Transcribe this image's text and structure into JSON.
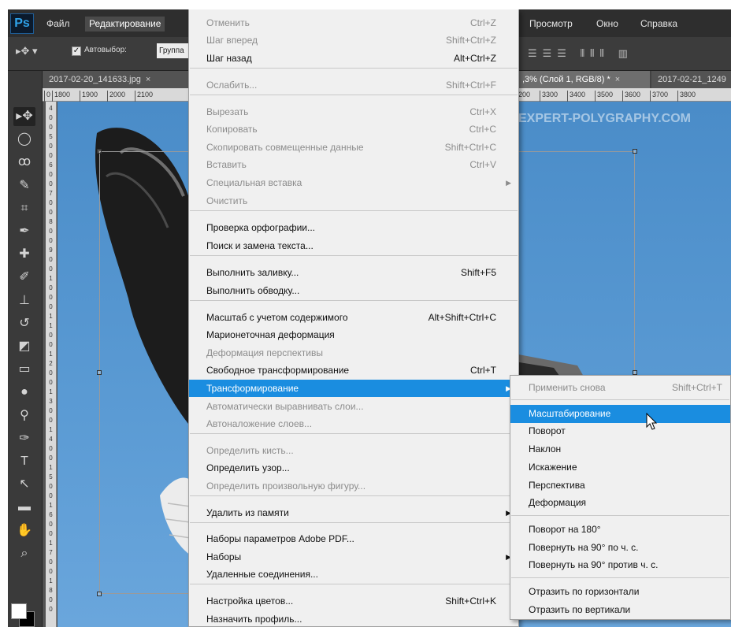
{
  "app": {
    "logo": "Ps"
  },
  "menubar": [
    {
      "label": "Файл"
    },
    {
      "label": "Редактирование"
    },
    {
      "label": "Просмотр"
    },
    {
      "label": "Окно"
    },
    {
      "label": "Справка"
    }
  ],
  "options_bar": {
    "auto_select_label": "Автовыбор:",
    "auto_select_checked": true,
    "target_value": "Группа"
  },
  "tabs": [
    {
      "title": "2017-02-20_141633.jpg",
      "close": "×"
    },
    {
      "title": ",3% (Слой 1, RGB/8) *",
      "close": "×"
    },
    {
      "title": "2017-02-21_1249"
    }
  ],
  "ruler_h": [
    "0",
    "1800",
    "1900",
    "2000",
    "2100",
    "3200",
    "3300",
    "3400",
    "3500",
    "3600",
    "3700",
    "3800"
  ],
  "ruler_v": [
    "4",
    "0",
    "0",
    "5",
    "0",
    "0",
    "6",
    "0",
    "0",
    "7",
    "0",
    "0",
    "8",
    "0",
    "0",
    "9",
    "0",
    "0",
    "1",
    "0",
    "0",
    "0",
    "1",
    "1",
    "0",
    "0",
    "1",
    "2",
    "0",
    "0",
    "1",
    "3",
    "0",
    "0",
    "1",
    "4",
    "0",
    "0",
    "1",
    "5",
    "0",
    "0",
    "1",
    "6",
    "0",
    "0",
    "1",
    "7",
    "0",
    "0",
    "1",
    "8",
    "0",
    "0"
  ],
  "watermark": "EXPERT-POLYGRAPHY.COM",
  "edit_menu": {
    "items": [
      {
        "label": "Отменить",
        "shortcut": "Ctrl+Z",
        "disabled": true
      },
      {
        "label": "Шаг вперед",
        "shortcut": "Shift+Ctrl+Z",
        "disabled": true
      },
      {
        "label": "Шаг назад",
        "shortcut": "Alt+Ctrl+Z",
        "disabled": false
      },
      {
        "label": "Ослабить...",
        "shortcut": "Shift+Ctrl+F",
        "disabled": true
      },
      {
        "label": "Вырезать",
        "shortcut": "Ctrl+X",
        "disabled": true
      },
      {
        "label": "Копировать",
        "shortcut": "Ctrl+C",
        "disabled": true
      },
      {
        "label": "Скопировать совмещенные данные",
        "shortcut": "Shift+Ctrl+C",
        "disabled": true
      },
      {
        "label": "Вставить",
        "shortcut": "Ctrl+V",
        "disabled": true
      },
      {
        "label": "Специальная вставка",
        "shortcut": "",
        "disabled": true,
        "submenu": true
      },
      {
        "label": "Очистить",
        "shortcut": "",
        "disabled": true
      },
      {
        "label": "Проверка орфографии...",
        "shortcut": "",
        "disabled": false
      },
      {
        "label": "Поиск и замена текста...",
        "shortcut": "",
        "disabled": false
      },
      {
        "label": "Выполнить заливку...",
        "shortcut": "Shift+F5",
        "disabled": false
      },
      {
        "label": "Выполнить обводку...",
        "shortcut": "",
        "disabled": false
      },
      {
        "label": "Масштаб с учетом содержимого",
        "shortcut": "Alt+Shift+Ctrl+C",
        "disabled": false
      },
      {
        "label": "Марионеточная деформация",
        "shortcut": "",
        "disabled": false
      },
      {
        "label": "Деформация перспективы",
        "shortcut": "",
        "disabled": true
      },
      {
        "label": "Свободное трансформирование",
        "shortcut": "Ctrl+T",
        "disabled": false
      },
      {
        "label": "Трансформирование",
        "shortcut": "",
        "disabled": false,
        "submenu": true,
        "highlighted": true
      },
      {
        "label": "Автоматически выравнивать слои...",
        "shortcut": "",
        "disabled": true
      },
      {
        "label": "Автоналожение слоев...",
        "shortcut": "",
        "disabled": true
      },
      {
        "label": "Определить кисть...",
        "shortcut": "",
        "disabled": true
      },
      {
        "label": "Определить узор...",
        "shortcut": "",
        "disabled": false
      },
      {
        "label": "Определить произвольную фигуру...",
        "shortcut": "",
        "disabled": true
      },
      {
        "label": "Удалить из памяти",
        "shortcut": "",
        "disabled": false,
        "submenu": true
      },
      {
        "label": "Наборы параметров Adobe PDF...",
        "shortcut": "",
        "disabled": false
      },
      {
        "label": "Наборы",
        "shortcut": "",
        "disabled": false,
        "submenu": true
      },
      {
        "label": "Удаленные соединения...",
        "shortcut": "",
        "disabled": false
      },
      {
        "label": "Настройка цветов...",
        "shortcut": "Shift+Ctrl+K",
        "disabled": false
      },
      {
        "label": "Назначить профиль...",
        "shortcut": "",
        "disabled": false
      }
    ]
  },
  "transform_submenu": {
    "items": [
      {
        "label": "Применить снова",
        "shortcut": "Shift+Ctrl+T",
        "disabled": true
      },
      {
        "label": "Масштабирование",
        "shortcut": "",
        "disabled": false,
        "highlighted": true
      },
      {
        "label": "Поворот",
        "shortcut": "",
        "disabled": false
      },
      {
        "label": "Наклон",
        "shortcut": "",
        "disabled": false
      },
      {
        "label": "Искажение",
        "shortcut": "",
        "disabled": false
      },
      {
        "label": "Перспектива",
        "shortcut": "",
        "disabled": false
      },
      {
        "label": "Деформация",
        "shortcut": "",
        "disabled": false
      },
      {
        "label": "Поворот на 180°",
        "shortcut": "",
        "disabled": false
      },
      {
        "label": "Повернуть на 90° по ч. с.",
        "shortcut": "",
        "disabled": false
      },
      {
        "label": "Повернуть на 90° против ч. с.",
        "shortcut": "",
        "disabled": false
      },
      {
        "label": "Отразить по горизонтали",
        "shortcut": "",
        "disabled": false
      },
      {
        "label": "Отразить по вертикали",
        "shortcut": "",
        "disabled": false
      }
    ]
  },
  "tools": [
    {
      "icon": "move-icon",
      "glyph": "▸✥",
      "active": true
    },
    {
      "icon": "marquee-icon",
      "glyph": "◯"
    },
    {
      "icon": "lasso-icon",
      "glyph": "ꝏ"
    },
    {
      "icon": "quick-select-icon",
      "glyph": "✎"
    },
    {
      "icon": "crop-icon",
      "glyph": "⌗"
    },
    {
      "icon": "eyedropper-icon",
      "glyph": "✒"
    },
    {
      "icon": "healing-icon",
      "glyph": "✚"
    },
    {
      "icon": "brush-icon",
      "glyph": "✐"
    },
    {
      "icon": "stamp-icon",
      "glyph": "⊥"
    },
    {
      "icon": "history-brush-icon",
      "glyph": "↺"
    },
    {
      "icon": "eraser-icon",
      "glyph": "◩"
    },
    {
      "icon": "gradient-icon",
      "glyph": "▭"
    },
    {
      "icon": "blur-icon",
      "glyph": "●"
    },
    {
      "icon": "dodge-icon",
      "glyph": "⚲"
    },
    {
      "icon": "pen-icon",
      "glyph": "✑"
    },
    {
      "icon": "type-icon",
      "glyph": "T"
    },
    {
      "icon": "path-select-icon",
      "glyph": "↖"
    },
    {
      "icon": "shape-icon",
      "glyph": "▬"
    },
    {
      "icon": "hand-icon",
      "glyph": "✋"
    },
    {
      "icon": "zoom-icon",
      "glyph": "⌕"
    }
  ]
}
